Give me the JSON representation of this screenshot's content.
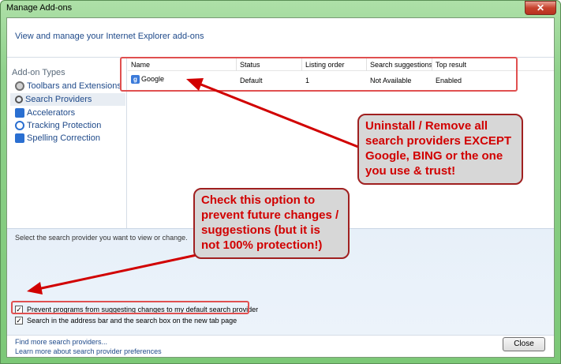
{
  "window": {
    "title": "Manage Add-ons",
    "close_glyph": "✕",
    "header_text": "View and manage your Internet Explorer add-ons"
  },
  "sidebar": {
    "title": "Add-on Types",
    "items": [
      {
        "label": "Toolbars and Extensions",
        "icon": "gear-icon"
      },
      {
        "label": "Search Providers",
        "icon": "search-icon"
      },
      {
        "label": "Accelerators",
        "icon": "accelerator-icon"
      },
      {
        "label": "Tracking Protection",
        "icon": "tracking-protection-icon"
      },
      {
        "label": "Spelling Correction",
        "icon": "spelling-icon"
      }
    ]
  },
  "list": {
    "columns": [
      "Name",
      "Status",
      "Listing order",
      "Search suggestions",
      "Top result"
    ],
    "rows": [
      {
        "name": "Google",
        "status": "Default",
        "listing_order": "1",
        "search_suggestions": "Not Available",
        "top_result": "Enabled"
      }
    ]
  },
  "bottom": {
    "prompt": "Select the search provider you want to view or change.",
    "checks": [
      {
        "label": "Prevent programs from suggesting changes to my default search provider",
        "checked": true
      },
      {
        "label": "Search in the address bar and the search box on the new tab page",
        "checked": true
      }
    ]
  },
  "footer": {
    "links": [
      "Find more search providers...",
      "Learn more about search provider preferences"
    ],
    "close_label": "Close"
  },
  "annotations": {
    "callout_top": "Uninstall / Remove all search providers EXCEPT Google, BING or the one you use & trust!",
    "callout_mid": "Check this option to prevent future changes / suggestions (but it is not 100% protection!)",
    "color": "#d10000"
  }
}
